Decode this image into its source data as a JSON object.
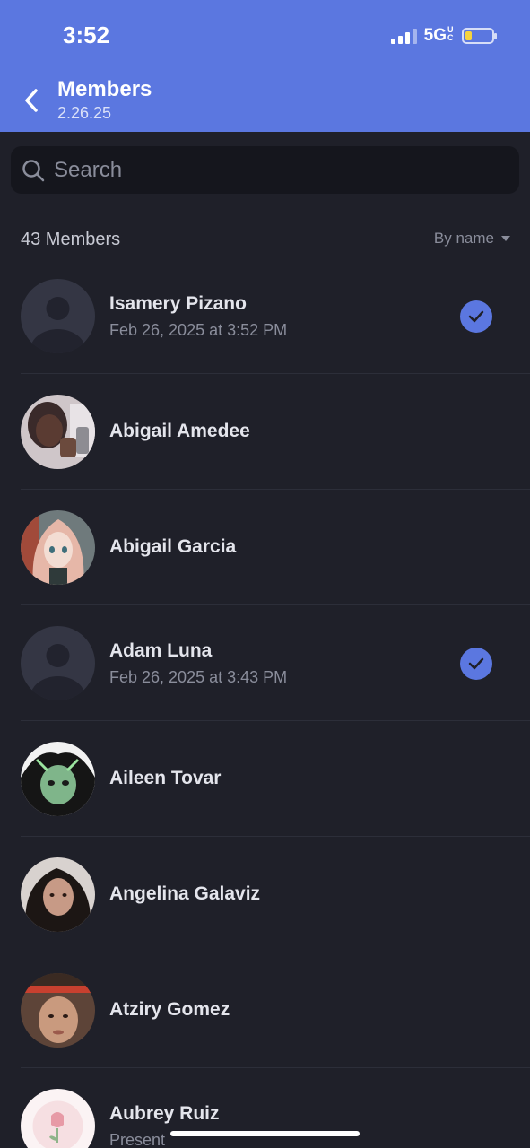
{
  "status_bar": {
    "time": "3:52",
    "network": "5G",
    "network_sub": "UC"
  },
  "nav": {
    "title": "Members",
    "subtitle": "2.26.25"
  },
  "search": {
    "placeholder": "Search"
  },
  "summary": {
    "count_label": "43 Members",
    "sort_label": "By name"
  },
  "colors": {
    "accent": "#5b77e0",
    "background": "#1f2029",
    "battery": "#f5d33e"
  },
  "members": [
    {
      "name": "Isamery Pizano",
      "subtitle": "Feb 26, 2025 at 3:52 PM",
      "checked": true,
      "avatar": "default-avatar"
    },
    {
      "name": "Abigail Amedee",
      "subtitle": "",
      "checked": false,
      "avatar": "photo-avatar"
    },
    {
      "name": "Abigail Garcia",
      "subtitle": "",
      "checked": false,
      "avatar": "anime-avatar"
    },
    {
      "name": "Adam Luna",
      "subtitle": "Feb 26, 2025 at 3:43 PM",
      "checked": true,
      "avatar": "default-avatar"
    },
    {
      "name": "Aileen Tovar",
      "subtitle": "",
      "checked": false,
      "avatar": "green-cartoon-avatar"
    },
    {
      "name": "Angelina Galaviz",
      "subtitle": "",
      "checked": false,
      "avatar": "photo-avatar"
    },
    {
      "name": "Atziry Gomez",
      "subtitle": "",
      "checked": false,
      "avatar": "photo-avatar"
    },
    {
      "name": "Aubrey Ruiz",
      "subtitle": "Present",
      "checked": false,
      "avatar": "tulip-avatar"
    }
  ]
}
